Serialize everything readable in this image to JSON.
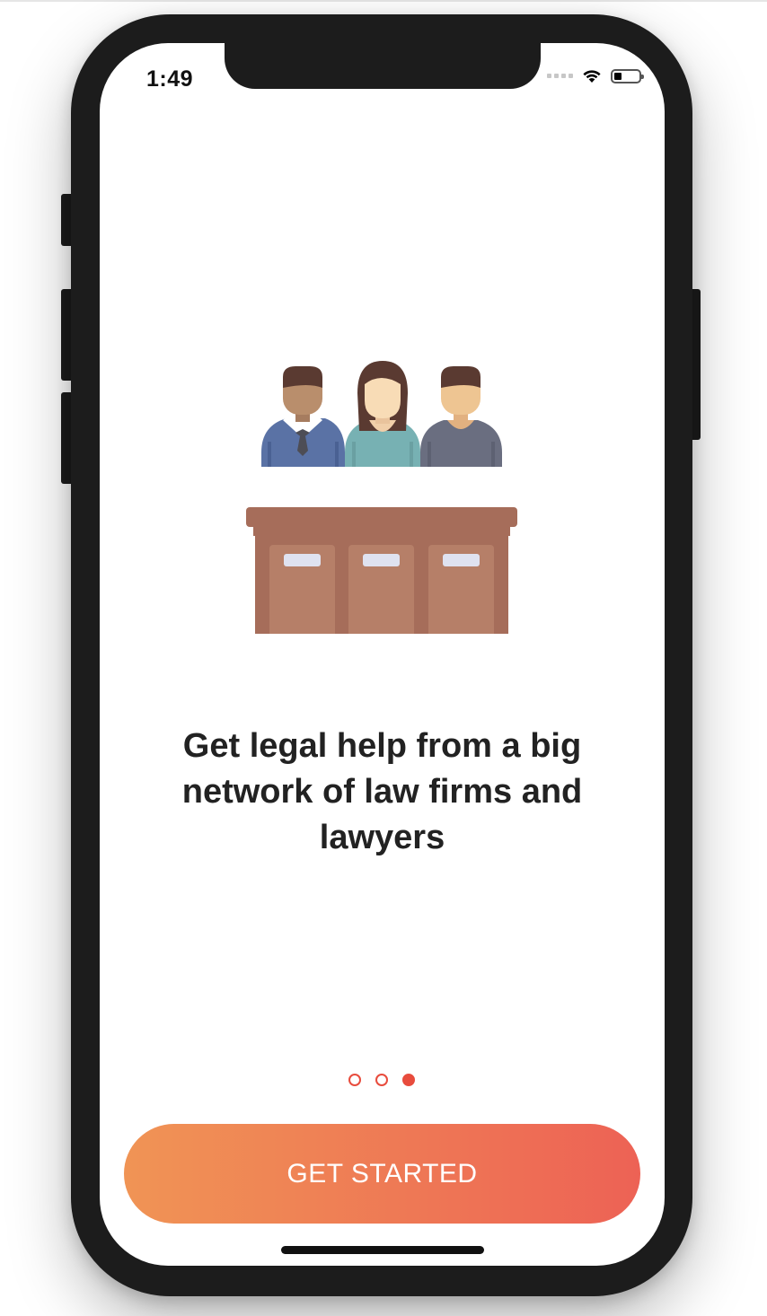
{
  "status_bar": {
    "time": "1:49",
    "icons": [
      "signal-icon",
      "wifi-icon",
      "battery-icon"
    ]
  },
  "onboarding": {
    "illustration": "jury-box-illustration",
    "headline": "Get legal help from a big network of law firms and lawyers",
    "page_count": 3,
    "current_page": 3,
    "cta_label": "GET STARTED"
  },
  "colors": {
    "accent": "#e84c3d",
    "button_gradient_start": "#f09455",
    "button_gradient_end": "#ed6255",
    "text": "#222222"
  }
}
